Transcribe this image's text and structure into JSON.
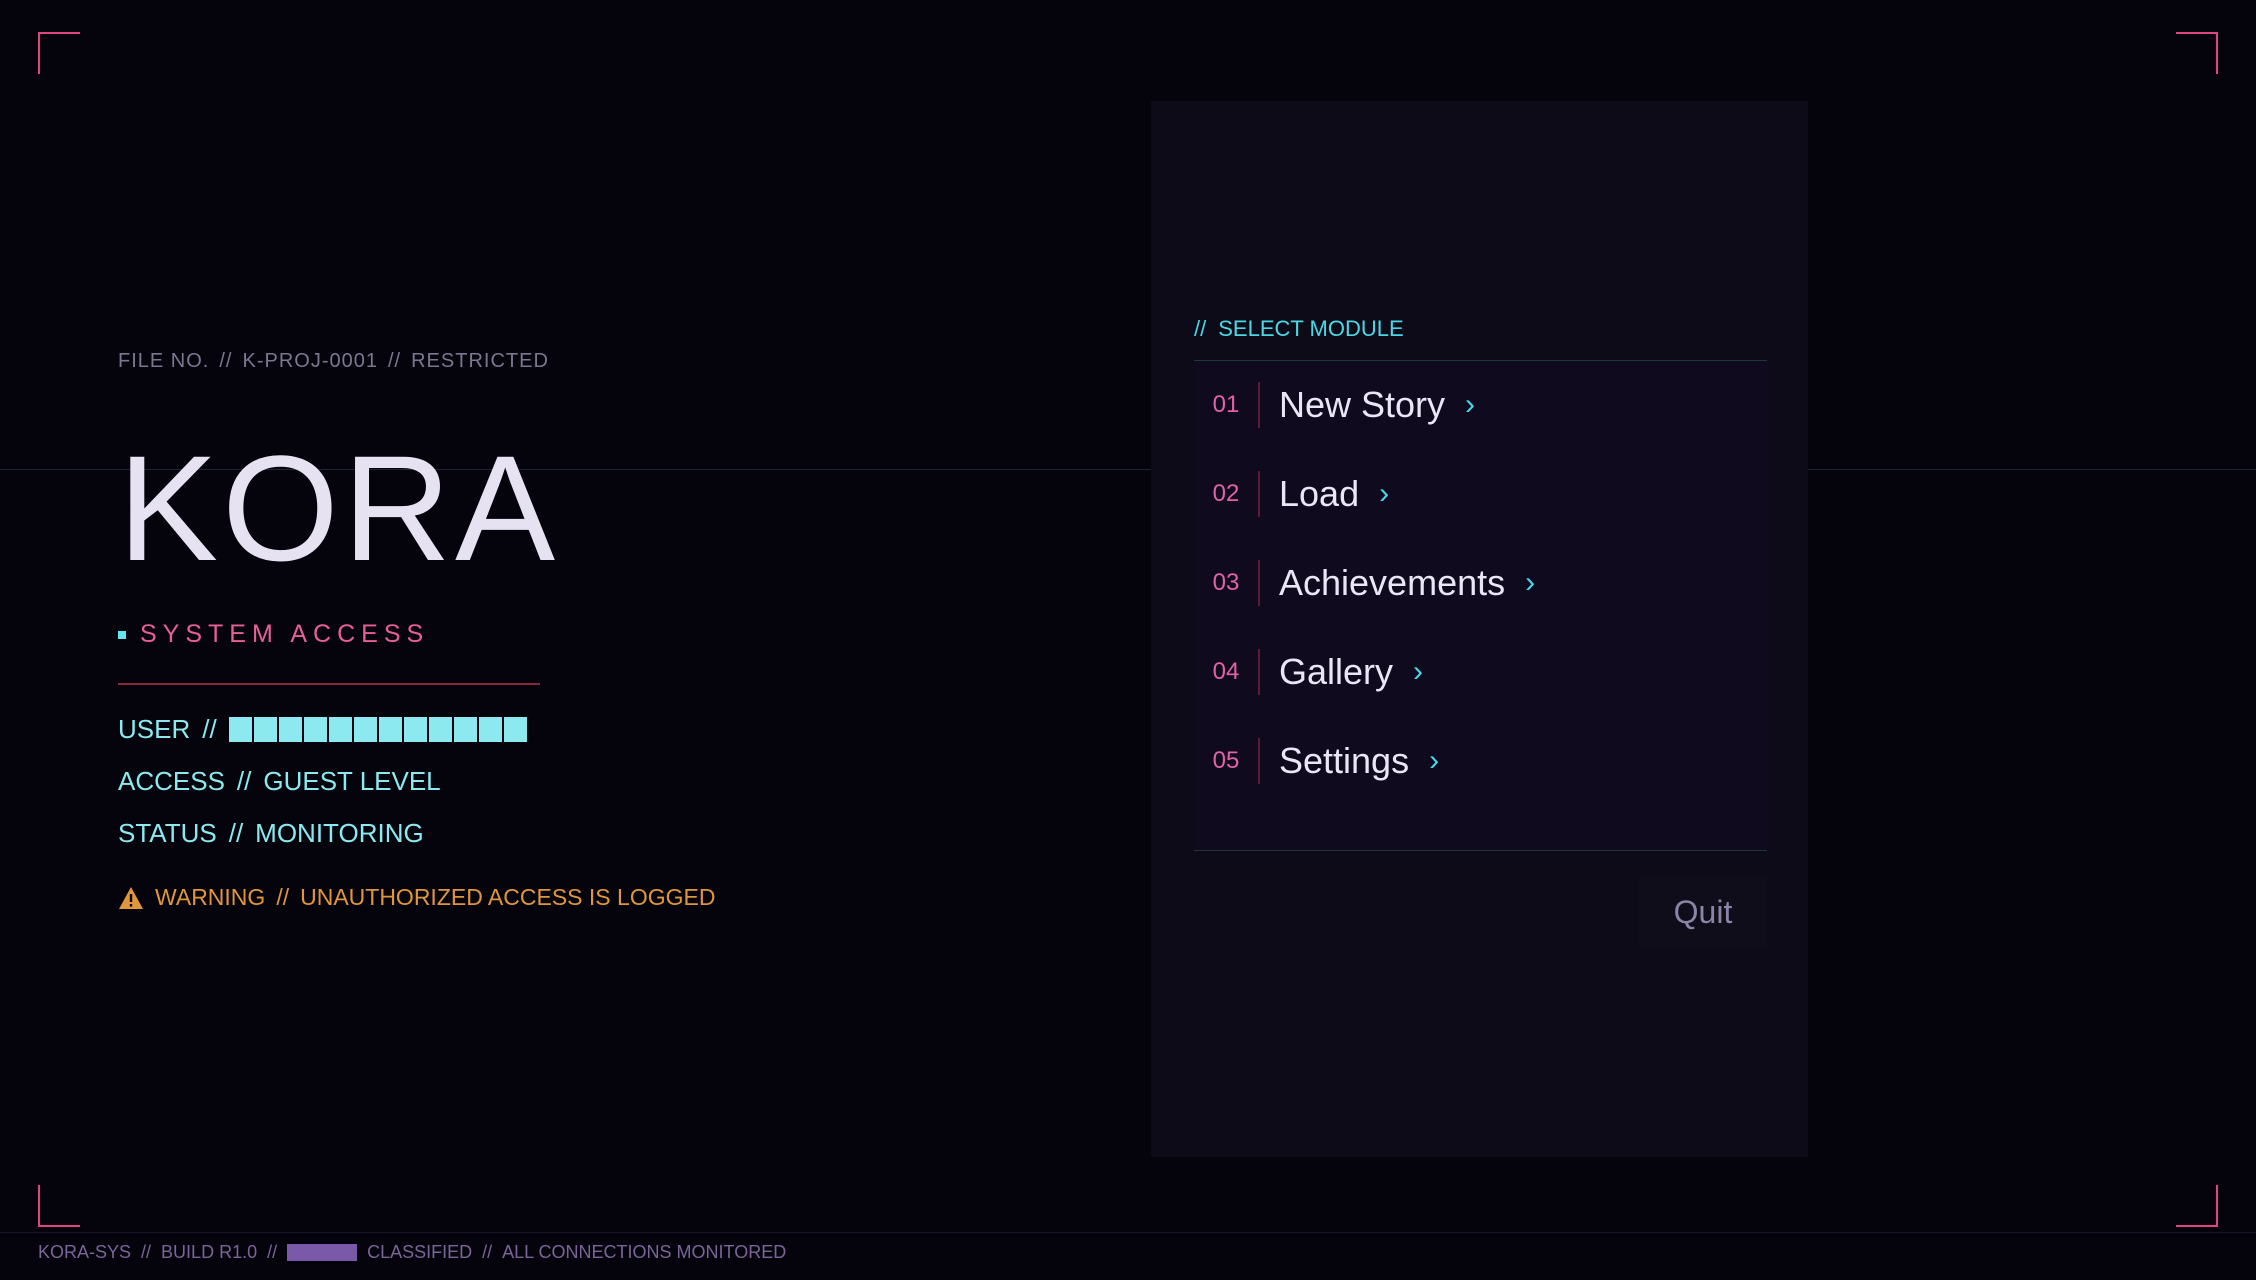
{
  "file_info": {
    "file_label": "FILE NO.",
    "file_number": "K-PROJ-0001",
    "classification": "RESTRICTED",
    "separator": "//"
  },
  "title": "KORA",
  "subtitle": "SYSTEM ACCESS",
  "user_info": {
    "user_label": "USER",
    "user_value_redacted": true,
    "access_label": "ACCESS",
    "access_value": "GUEST LEVEL",
    "status_label": "STATUS",
    "status_value": "MONITORING"
  },
  "warning": {
    "icon": "warning-triangle-icon",
    "label": "WARNING",
    "message": "UNAUTHORIZED ACCESS IS LOGGED"
  },
  "menu": {
    "header_prefix": "//",
    "header": "SELECT MODULE",
    "items": [
      {
        "number": "01",
        "label": "New Story",
        "chevron": "›"
      },
      {
        "number": "02",
        "label": "Load",
        "chevron": "›"
      },
      {
        "number": "03",
        "label": "Achievements",
        "chevron": "›"
      },
      {
        "number": "04",
        "label": "Gallery",
        "chevron": "›"
      },
      {
        "number": "05",
        "label": "Settings",
        "chevron": "›"
      }
    ],
    "quit_label": "Quit"
  },
  "footer": {
    "system": "KORA-SYS",
    "build": "BUILD R1.0",
    "classified": "CLASSIFIED",
    "notice": "ALL CONNECTIONS MONITORED",
    "separator": "//"
  },
  "colors": {
    "background": "#05040d",
    "accent_pink": "#e0457f",
    "accent_cyan": "#8be9ef",
    "warning_orange": "#e0963c",
    "panel": "#0d0b17",
    "footer_purple": "#7a6498"
  }
}
